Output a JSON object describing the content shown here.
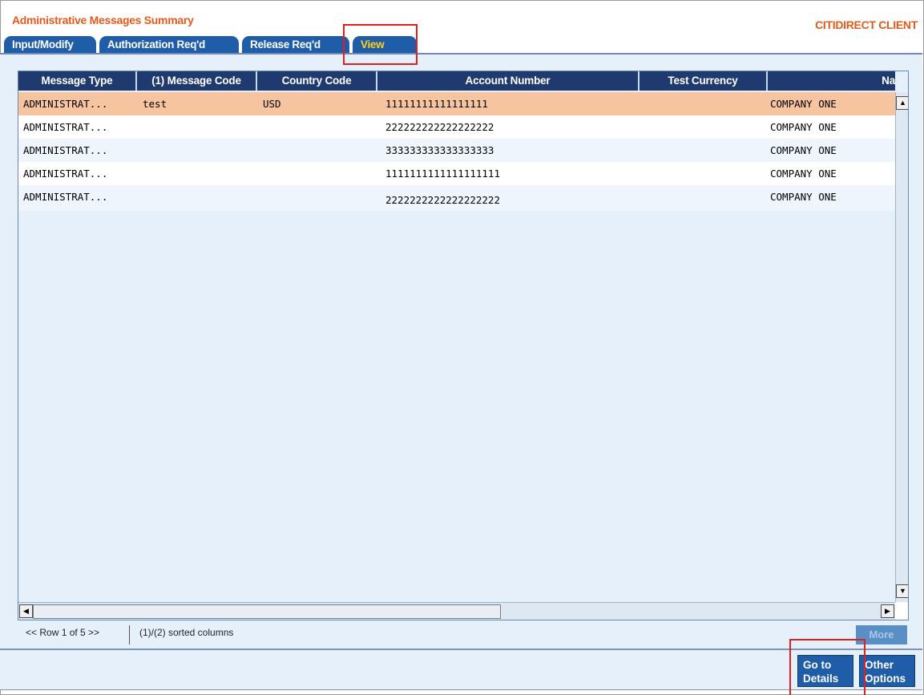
{
  "page": {
    "title": "Administrative Messages Summary",
    "client": "CITIDIRECT CLIENT"
  },
  "tabs": [
    {
      "label": "Input/Modify"
    },
    {
      "label": "Authorization Req'd"
    },
    {
      "label": "Release Req'd"
    },
    {
      "label": "View",
      "active": true
    }
  ],
  "grid": {
    "columns": [
      "Message Type",
      "(1) Message Code",
      "Country Code",
      "Account Number",
      "Test Currency",
      "Na"
    ],
    "rows": [
      {
        "message_type": "ADMINISTRAT...",
        "message_code": "test",
        "country_code": "USD",
        "account_number": "11111111111111111",
        "test_currency": "",
        "name": "COMPANY ONE",
        "selected": true
      },
      {
        "message_type": "ADMINISTRAT...",
        "message_code": "",
        "country_code": "",
        "account_number": "222222222222222222",
        "test_currency": "",
        "name": "COMPANY ONE"
      },
      {
        "message_type": "ADMINISTRAT...",
        "message_code": "",
        "country_code": "",
        "account_number": "333333333333333333",
        "test_currency": "",
        "name": "COMPANY ONE"
      },
      {
        "message_type": "ADMINISTRAT...",
        "message_code": "",
        "country_code": "",
        "account_number": "1111111111111111111",
        "test_currency": "",
        "name": "COMPANY ONE"
      },
      {
        "message_type": "ADMINISTRAT...",
        "message_code": "",
        "country_code": "",
        "account_number": "2222222222222222222",
        "test_currency": "",
        "name": "COMPANY ONE"
      }
    ]
  },
  "scroll": {
    "up": "▲",
    "down": "▼",
    "left": "◀",
    "right": "▶"
  },
  "status": {
    "row_nav": "<< Row 1 of 5 >>",
    "sorted": "(1)/(2) sorted columns",
    "more": "More"
  },
  "footer": {
    "go_to_details": [
      "Go to",
      "Details"
    ],
    "other_options": [
      "Other",
      "Options"
    ]
  },
  "colors": {
    "accent": "#e35a1a",
    "tab_blue": "#1f5da8",
    "header_navy": "#1f3a6e",
    "selected_row": "#f7c4a0",
    "highlight_red": "#e02020"
  }
}
